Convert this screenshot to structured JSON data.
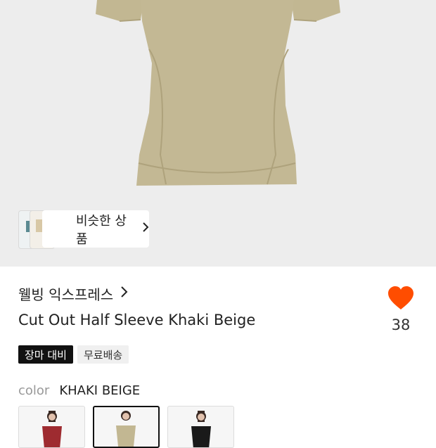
{
  "similar": {
    "label": "비슷한 상품",
    "chevron": "chevron-right-icon"
  },
  "brand": {
    "name": "웰빙 익스프레스",
    "chevron": "chevron-right-icon"
  },
  "product": {
    "title": "Cut Out Half Sleeve Khaki Beige"
  },
  "like": {
    "count": "38",
    "icon": "heart-icon",
    "color": "#ff4d00"
  },
  "badges": [
    "장마 대비",
    "무료배송"
  ],
  "color": {
    "label": "color",
    "value": "KHAKI BEIGE"
  },
  "colors": {
    "khaki": "#c2b792",
    "red": "#9e2b30",
    "black": "#1a1a1a",
    "hero_bg": "#ededed"
  }
}
